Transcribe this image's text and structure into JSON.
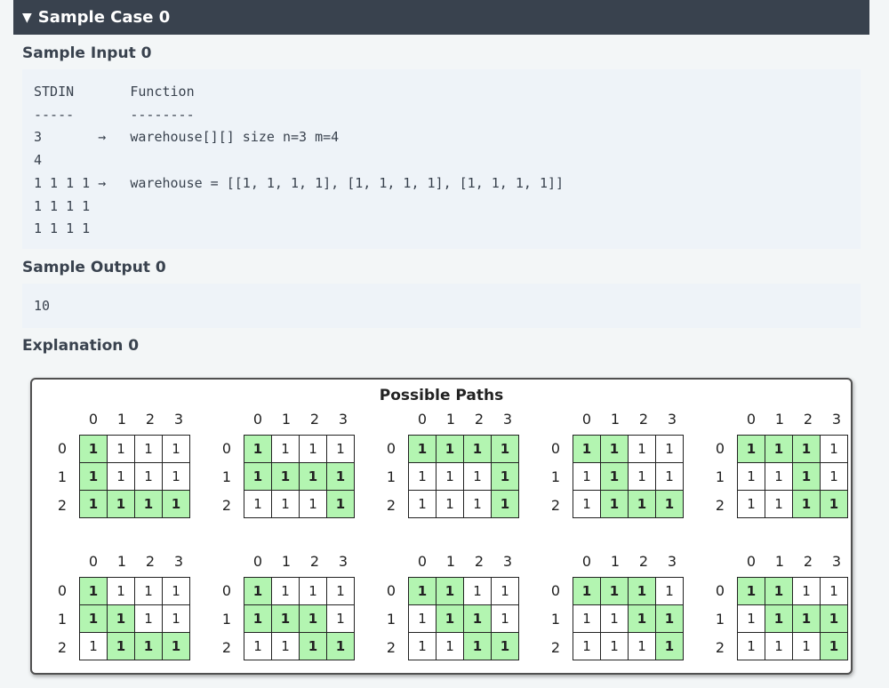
{
  "header": {
    "toggle_icon": "triangle-down-icon",
    "title": "Sample Case 0"
  },
  "input_section": {
    "title": "Sample Input 0",
    "lines": [
      "STDIN       Function",
      "-----       --------",
      "3       →   warehouse[][] size n=3 m=4",
      "4",
      "1 1 1 1 →   warehouse = [[1, 1, 1, 1], [1, 1, 1, 1], [1, 1, 1, 1]]",
      "1 1 1 1",
      "1 1 1 1"
    ]
  },
  "output_section": {
    "title": "Sample Output 0",
    "lines": [
      "10"
    ]
  },
  "explanation_section": {
    "title": "Explanation 0",
    "figure": {
      "title": "Possible Paths",
      "col_labels": [
        "0",
        "1",
        "2",
        "3"
      ],
      "row_labels": [
        "0",
        "1",
        "2"
      ],
      "colors": {
        "path": "#b3f5b1",
        "empty": "#ffffff"
      },
      "paths": [
        {
          "values": [
            [
              "1",
              "1",
              "1",
              "1"
            ],
            [
              "1",
              "1",
              "1",
              "1"
            ],
            [
              "1",
              "1",
              "1",
              "1"
            ]
          ],
          "highlight": [
            [
              1,
              0,
              0,
              0
            ],
            [
              1,
              0,
              0,
              0
            ],
            [
              1,
              1,
              1,
              1
            ]
          ]
        },
        {
          "values": [
            [
              "1",
              "1",
              "1",
              "1"
            ],
            [
              "1",
              "1",
              "1",
              "1"
            ],
            [
              "1",
              "1",
              "1",
              "1"
            ]
          ],
          "highlight": [
            [
              1,
              0,
              0,
              0
            ],
            [
              1,
              1,
              1,
              1
            ],
            [
              0,
              0,
              0,
              1
            ]
          ]
        },
        {
          "values": [
            [
              "1",
              "1",
              "1",
              "1"
            ],
            [
              "1",
              "1",
              "1",
              "1"
            ],
            [
              "1",
              "1",
              "1",
              "1"
            ]
          ],
          "highlight": [
            [
              1,
              1,
              1,
              1
            ],
            [
              0,
              0,
              0,
              1
            ],
            [
              0,
              0,
              0,
              1
            ]
          ]
        },
        {
          "values": [
            [
              "1",
              "1",
              "1",
              "1"
            ],
            [
              "1",
              "1",
              "1",
              "1"
            ],
            [
              "1",
              "1",
              "1",
              "1"
            ]
          ],
          "highlight": [
            [
              1,
              1,
              0,
              0
            ],
            [
              0,
              1,
              0,
              0
            ],
            [
              0,
              1,
              1,
              1
            ]
          ]
        },
        {
          "values": [
            [
              "1",
              "1",
              "1",
              "1"
            ],
            [
              "1",
              "1",
              "1",
              "1"
            ],
            [
              "1",
              "1",
              "1",
              "1"
            ]
          ],
          "highlight": [
            [
              1,
              1,
              1,
              0
            ],
            [
              0,
              0,
              1,
              0
            ],
            [
              0,
              0,
              1,
              1
            ]
          ]
        },
        {
          "values": [
            [
              "1",
              "1",
              "1",
              "1"
            ],
            [
              "1",
              "1",
              "1",
              "1"
            ],
            [
              "1",
              "1",
              "1",
              "1"
            ]
          ],
          "highlight": [
            [
              1,
              0,
              0,
              0
            ],
            [
              1,
              1,
              0,
              0
            ],
            [
              0,
              1,
              1,
              1
            ]
          ]
        },
        {
          "values": [
            [
              "1",
              "1",
              "1",
              "1"
            ],
            [
              "1",
              "1",
              "1",
              "1"
            ],
            [
              "1",
              "1",
              "1",
              "1"
            ]
          ],
          "highlight": [
            [
              1,
              0,
              0,
              0
            ],
            [
              1,
              1,
              1,
              0
            ],
            [
              0,
              0,
              1,
              1
            ]
          ]
        },
        {
          "values": [
            [
              "1",
              "1",
              "1",
              "1"
            ],
            [
              "1",
              "1",
              "1",
              "1"
            ],
            [
              "1",
              "1",
              "1",
              "1"
            ]
          ],
          "highlight": [
            [
              1,
              1,
              0,
              0
            ],
            [
              0,
              1,
              1,
              0
            ],
            [
              0,
              0,
              1,
              1
            ]
          ]
        },
        {
          "values": [
            [
              "1",
              "1",
              "1",
              "1"
            ],
            [
              "1",
              "1",
              "1",
              "1"
            ],
            [
              "1",
              "1",
              "1",
              "1"
            ]
          ],
          "highlight": [
            [
              1,
              1,
              1,
              0
            ],
            [
              0,
              0,
              1,
              1
            ],
            [
              0,
              0,
              0,
              1
            ]
          ]
        },
        {
          "values": [
            [
              "1",
              "1",
              "1",
              "1"
            ],
            [
              "1",
              "1",
              "1",
              "1"
            ],
            [
              "1",
              "1",
              "1",
              "1"
            ]
          ],
          "highlight": [
            [
              1,
              1,
              0,
              0
            ],
            [
              0,
              1,
              1,
              1
            ],
            [
              0,
              0,
              0,
              1
            ]
          ]
        }
      ]
    }
  }
}
